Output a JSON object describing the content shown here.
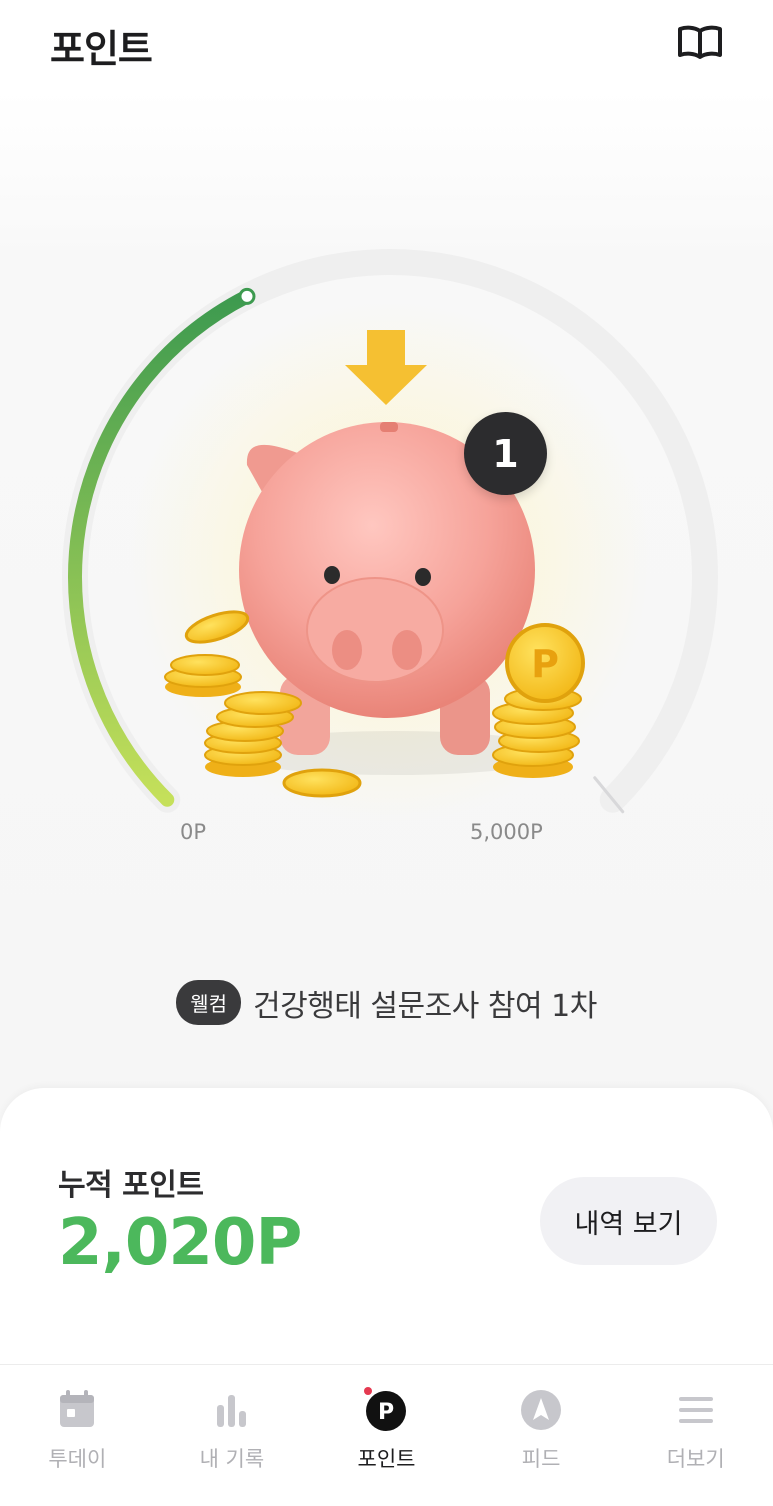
{
  "header": {
    "title": "포인트",
    "guide_icon": "open-book-icon"
  },
  "gauge": {
    "min_label": "0P",
    "max_label": "5,000P",
    "max_points": 5000,
    "progress_fraction": 0.4,
    "progress_color_start": "#c5e05a",
    "progress_color_end": "#3d9a4f",
    "track_color": "#efefef"
  },
  "piggy": {
    "stamp_count": "1",
    "coin_letter": "P"
  },
  "mission": {
    "tag": "웰컴",
    "text": "건강행태 설문조사 참여 1차"
  },
  "points": {
    "label": "누적 포인트",
    "value": "2,020P",
    "history_button": "내역 보기",
    "accent_color": "#4cb85c"
  },
  "tabs": [
    {
      "label": "투데이",
      "icon": "calendar-icon",
      "active": false
    },
    {
      "label": "내 기록",
      "icon": "bar-chart-icon",
      "active": false
    },
    {
      "label": "포인트",
      "icon": "point-p-icon",
      "active": true,
      "has_new": true
    },
    {
      "label": "피드",
      "icon": "compass-icon",
      "active": false
    },
    {
      "label": "더보기",
      "icon": "menu-icon",
      "active": false
    }
  ]
}
